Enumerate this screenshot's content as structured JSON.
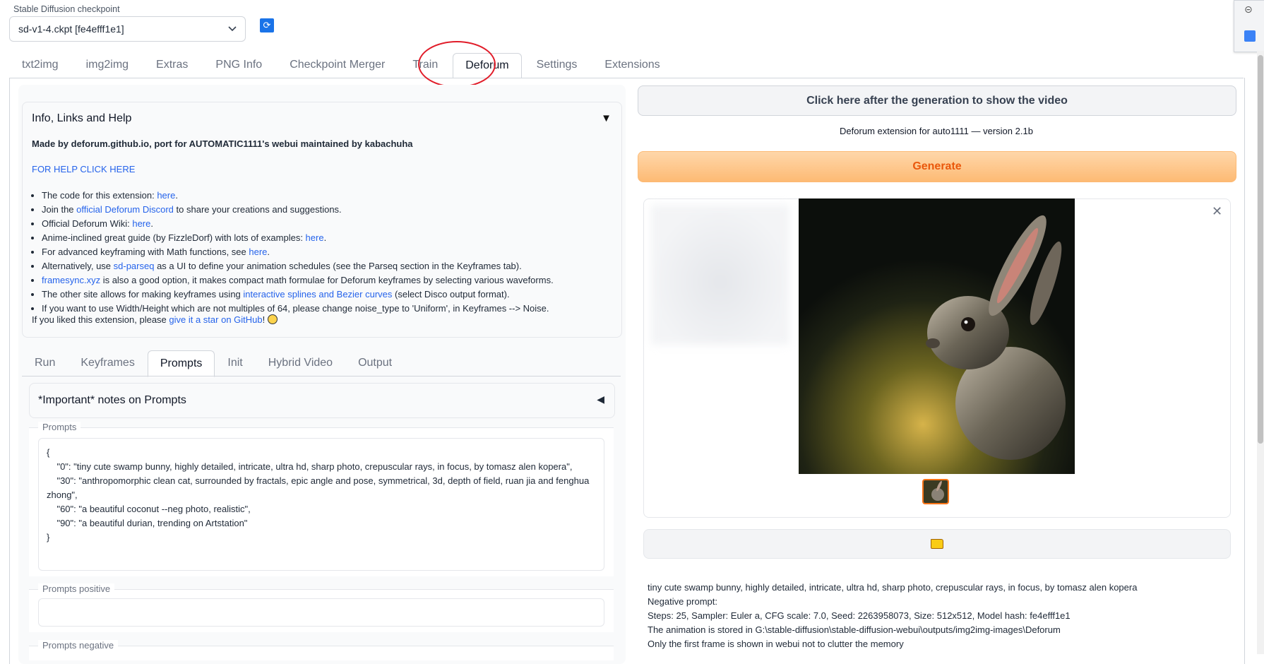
{
  "checkpoint": {
    "label": "Stable Diffusion checkpoint",
    "value": "sd-v1-4.ckpt [fe4efff1e1]"
  },
  "main_tabs": [
    "txt2img",
    "img2img",
    "Extras",
    "PNG Info",
    "Checkpoint Merger",
    "Train",
    "Deforum",
    "Settings",
    "Extensions"
  ],
  "active_main_tab": "Deforum",
  "info": {
    "title": "Info, Links and Help",
    "made_by": "Made by deforum.github.io, port for AUTOMATIC1111's webui maintained by kabachuha",
    "help_link": "FOR HELP CLICK HERE",
    "items": [
      {
        "pre": "The code for this extension: ",
        "link": "here",
        "post": "."
      },
      {
        "pre": "Join the ",
        "link": "official Deforum Discord",
        "post": " to share your creations and suggestions."
      },
      {
        "pre": "Official Deforum Wiki: ",
        "link": "here",
        "post": "."
      },
      {
        "pre": "Anime-inclined great guide (by FizzleDorf) with lots of examples: ",
        "link": "here",
        "post": "."
      },
      {
        "pre": "For advanced keyframing with Math functions, see ",
        "link": "here",
        "post": "."
      },
      {
        "pre": "Alternatively, use ",
        "link": "sd-parseq",
        "post": " as a UI to define your animation schedules (see the Parseq section in the Keyframes tab)."
      },
      {
        "pre": "",
        "link": "framesync.xyz",
        "post": " is also a good option, it makes compact math formulae for Deforum keyframes by selecting various waveforms."
      },
      {
        "pre": "The other site allows for making keyframes using ",
        "link": "interactive splines and Bezier curves",
        "post": " (select Disco output format)."
      },
      {
        "pre": "If you want to use Width/Height which are not multiples of 64, please change noise_type to 'Uniform', in Keyframes --> Noise.",
        "link": "",
        "post": ""
      }
    ],
    "liked_pre": "If you liked this extension, please ",
    "liked_link": "give it a star on GitHub",
    "liked_post": "!"
  },
  "sub_tabs": [
    "Run",
    "Keyframes",
    "Prompts",
    "Init",
    "Hybrid Video",
    "Output"
  ],
  "active_sub_tab": "Prompts",
  "notes_title": "*Important* notes on Prompts",
  "prompts": {
    "label": "Prompts",
    "value": "{\n    \"0\": \"tiny cute swamp bunny, highly detailed, intricate, ultra hd, sharp photo, crepuscular rays, in focus, by tomasz alen kopera\",\n    \"30\": \"anthropomorphic clean cat, surrounded by fractals, epic angle and pose, symmetrical, 3d, depth of field, ruan jia and fenghua zhong\",\n    \"60\": \"a beautiful coconut --neg photo, realistic\",\n    \"90\": \"a beautiful durian, trending on Artstation\"\n}"
  },
  "prompts_positive": {
    "label": "Prompts positive",
    "value": ""
  },
  "prompts_negative": {
    "label": "Prompts negative"
  },
  "right": {
    "video_button": "Click here after the generation to show the video",
    "version": "Deforum extension for auto1111 — version 2.1b",
    "generate_button": "Generate",
    "output_lines": [
      "tiny cute swamp bunny, highly detailed, intricate, ultra hd, sharp photo, crepuscular rays, in focus, by tomasz alen kopera",
      "Negative prompt:",
      "Steps: 25, Sampler: Euler a, CFG scale: 7.0, Seed: 2263958073, Size: 512x512, Model hash: fe4efff1e1",
      "The animation is stored in G:\\stable-diffusion\\stable-diffusion-webui\\outputs/img2img-images\\Deforum",
      "Only the first frame is shown in webui not to clutter the memory"
    ]
  },
  "icons": {
    "refresh": "refresh-icon",
    "dropdown": "chevron-down-icon",
    "collapse": "triangle-down-icon",
    "expand": "triangle-left-icon",
    "close": "close-icon",
    "folder": "folder-icon"
  },
  "colors": {
    "accent": "#ea580c",
    "link": "#2563eb",
    "highlight_circle": "#e11d2a"
  }
}
